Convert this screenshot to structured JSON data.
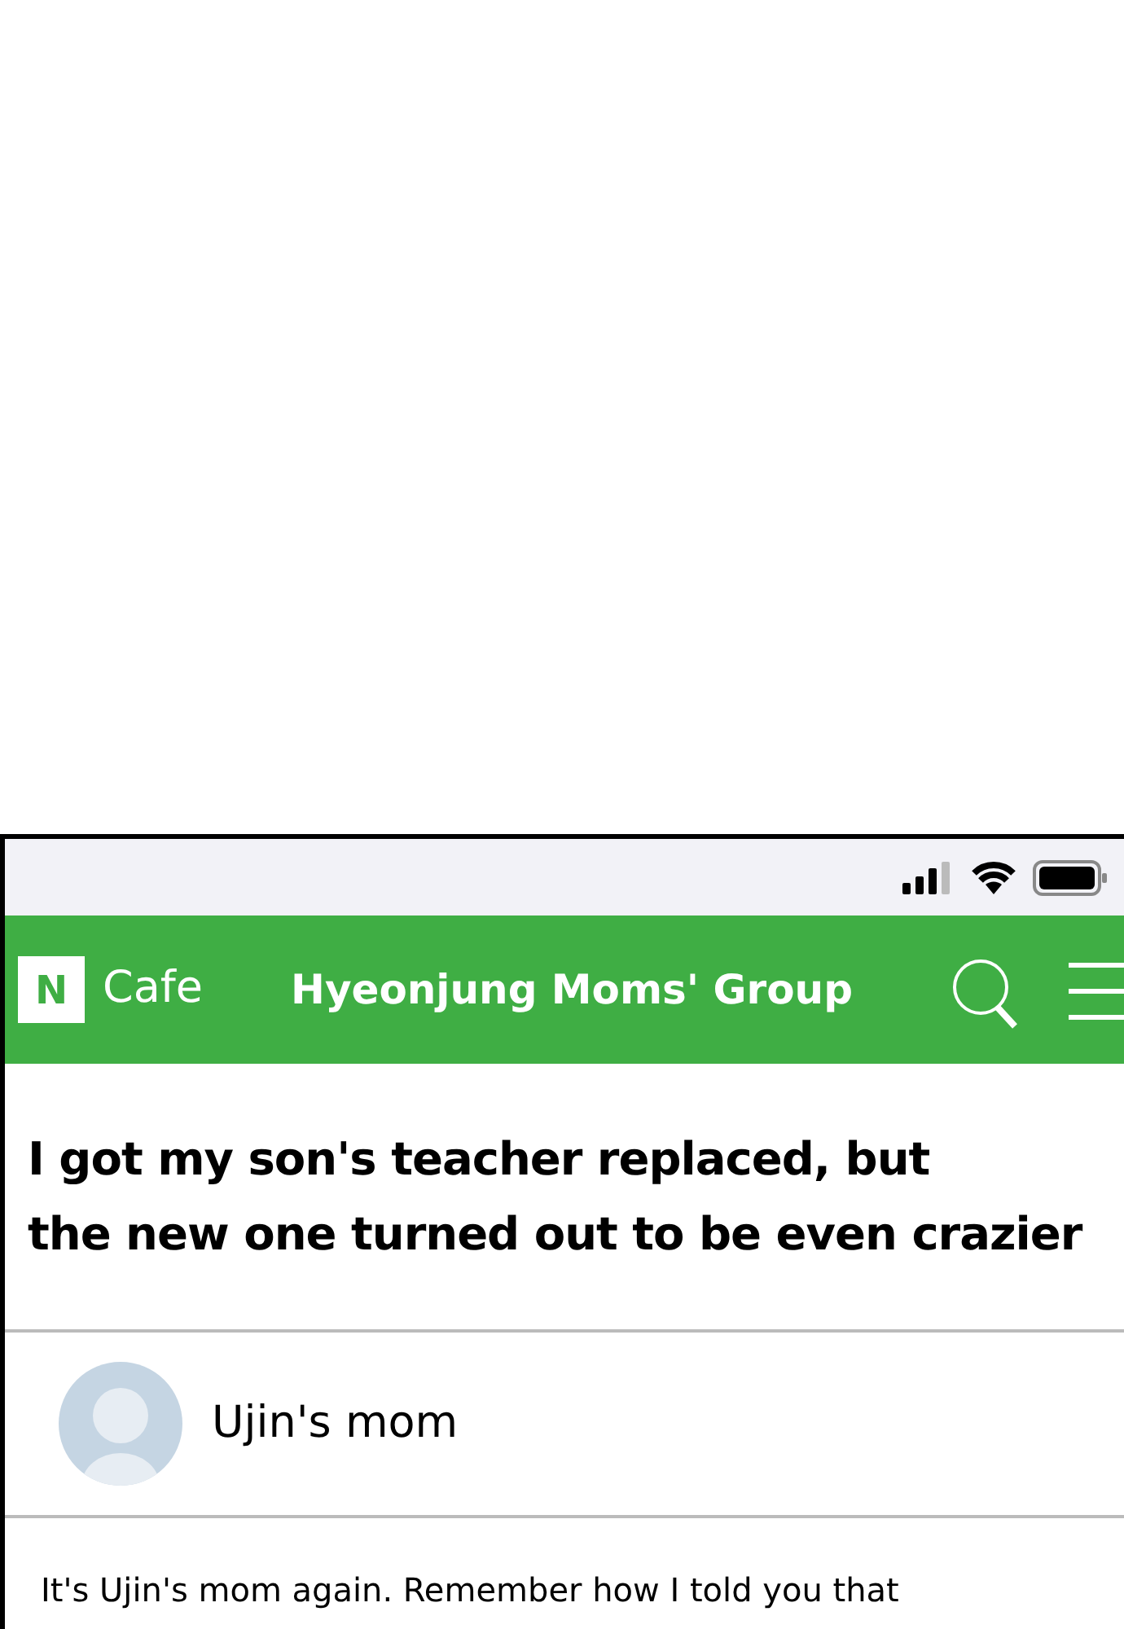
{
  "app_bar": {
    "logo_letter": "N",
    "brand": "Cafe",
    "title": "Hyeonjung Moms' Group"
  },
  "post": {
    "title_lines": [
      "I got my son's teacher replaced, but",
      "the new one turned out to be even crazier"
    ],
    "author": "Ujin's mom",
    "body": "It's Ujin's mom again. Remember how I told you that"
  }
}
